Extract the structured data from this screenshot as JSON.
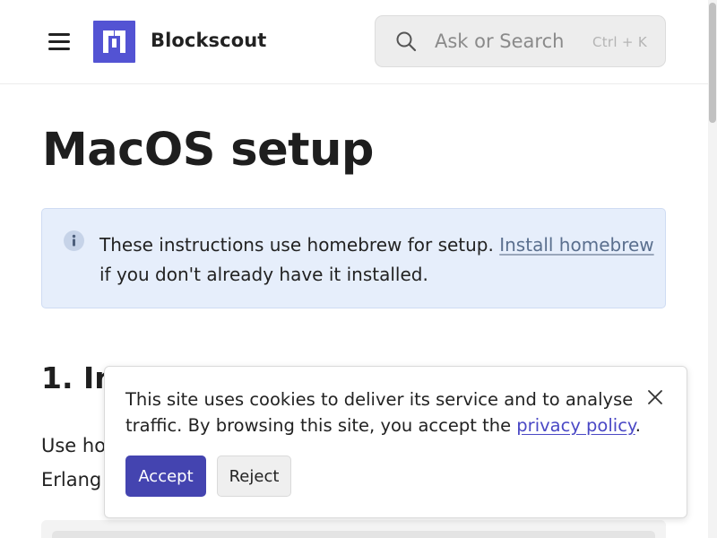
{
  "header": {
    "brand": "Blockscout",
    "menu_icon": "hamburger-menu-icon",
    "logo_icon": "blockscout-logo-icon",
    "search": {
      "placeholder": "Ask or Search",
      "shortcut": "Ctrl + K",
      "icon": "search-icon"
    }
  },
  "page": {
    "title": "MacOS setup",
    "callout": {
      "icon": "info-icon",
      "text_before": "These instructions use homebrew for setup. ",
      "link_text": "Install homebrew",
      "text_after": " if you don't already have it installed."
    },
    "section_heading": "1. In",
    "body_line1": "Use ho",
    "body_line2": "Erlang"
  },
  "cookie_banner": {
    "text_before": "This site uses cookies to deliver its service and to analyse traffic. By browsing this site, you accept the ",
    "link_text": "privacy policy",
    "text_after": ".",
    "accept_label": "Accept",
    "reject_label": "Reject",
    "close_icon": "close-icon"
  },
  "colors": {
    "brand": "#5353d3",
    "accept_button": "#4444b0",
    "callout_bg": "#e6eefb",
    "link": "#4a48c5"
  }
}
